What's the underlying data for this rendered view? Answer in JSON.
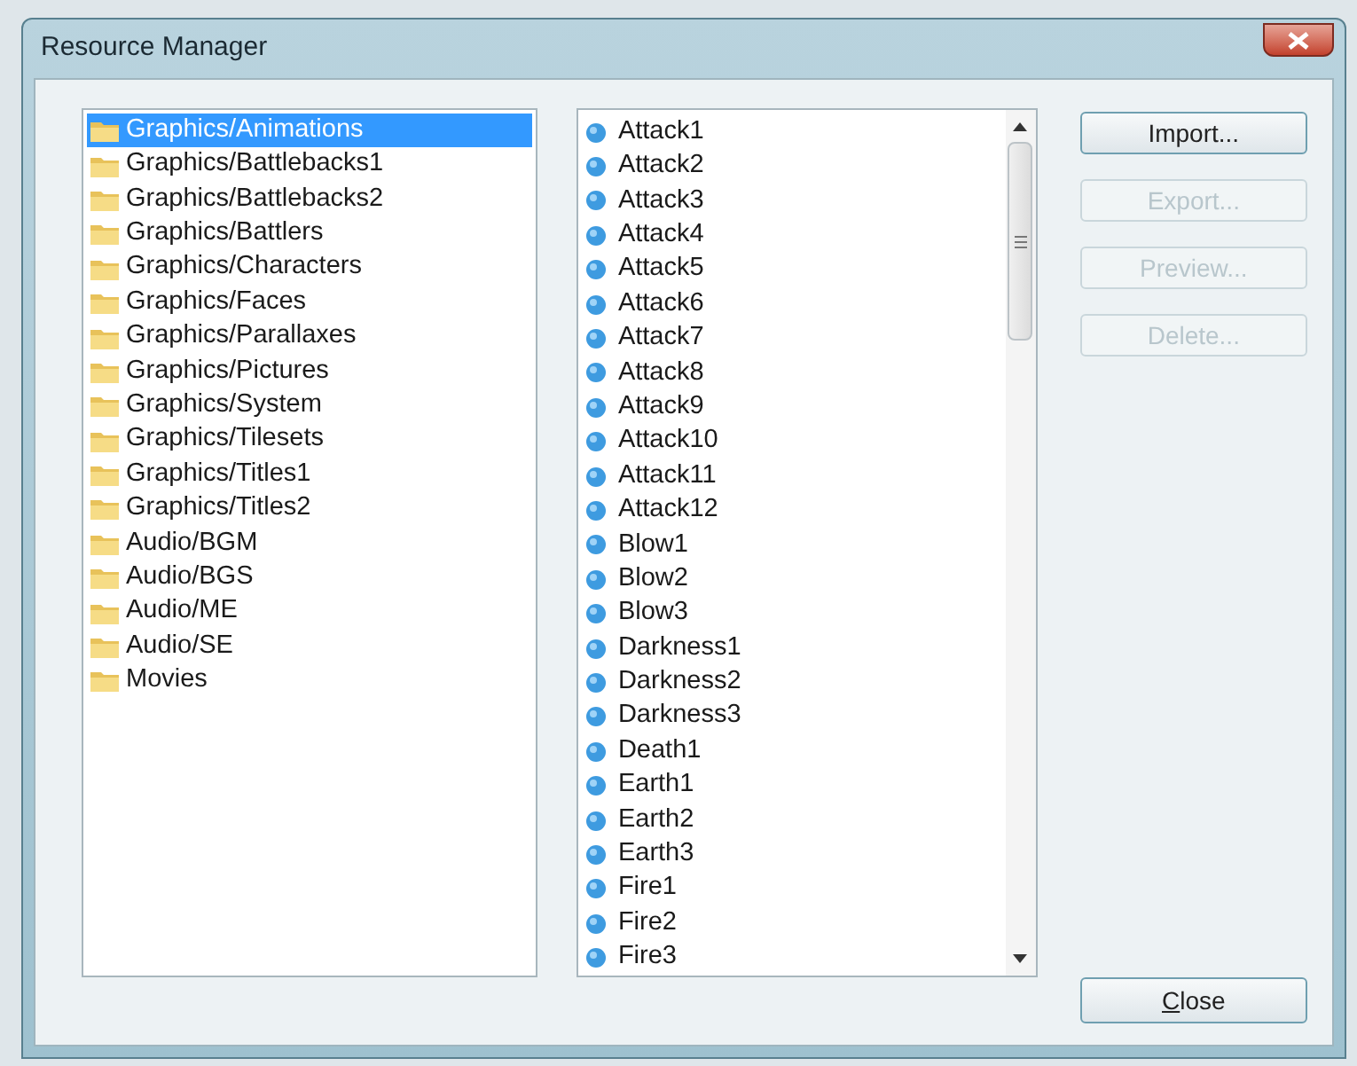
{
  "window": {
    "title": "Resource Manager"
  },
  "folders": [
    {
      "label": "Graphics/Animations",
      "selected": true
    },
    {
      "label": "Graphics/Battlebacks1",
      "selected": false
    },
    {
      "label": "Graphics/Battlebacks2",
      "selected": false
    },
    {
      "label": "Graphics/Battlers",
      "selected": false
    },
    {
      "label": "Graphics/Characters",
      "selected": false
    },
    {
      "label": "Graphics/Faces",
      "selected": false
    },
    {
      "label": "Graphics/Parallaxes",
      "selected": false
    },
    {
      "label": "Graphics/Pictures",
      "selected": false
    },
    {
      "label": "Graphics/System",
      "selected": false
    },
    {
      "label": "Graphics/Tilesets",
      "selected": false
    },
    {
      "label": "Graphics/Titles1",
      "selected": false
    },
    {
      "label": "Graphics/Titles2",
      "selected": false
    },
    {
      "label": "Audio/BGM",
      "selected": false
    },
    {
      "label": "Audio/BGS",
      "selected": false
    },
    {
      "label": "Audio/ME",
      "selected": false
    },
    {
      "label": "Audio/SE",
      "selected": false
    },
    {
      "label": "Movies",
      "selected": false
    }
  ],
  "files": [
    "Attack1",
    "Attack2",
    "Attack3",
    "Attack4",
    "Attack5",
    "Attack6",
    "Attack7",
    "Attack8",
    "Attack9",
    "Attack10",
    "Attack11",
    "Attack12",
    "Blow1",
    "Blow2",
    "Blow3",
    "Darkness1",
    "Darkness2",
    "Darkness3",
    "Death1",
    "Earth1",
    "Earth2",
    "Earth3",
    "Fire1",
    "Fire2",
    "Fire3"
  ],
  "buttons": [
    {
      "label": "Import...",
      "disabled": false
    },
    {
      "label": "Export...",
      "disabled": true
    },
    {
      "label": "Preview...",
      "disabled": true
    },
    {
      "label": "Delete...",
      "disabled": true
    }
  ],
  "close_button": {
    "label": "Close",
    "mnemonic_underlined": true
  }
}
